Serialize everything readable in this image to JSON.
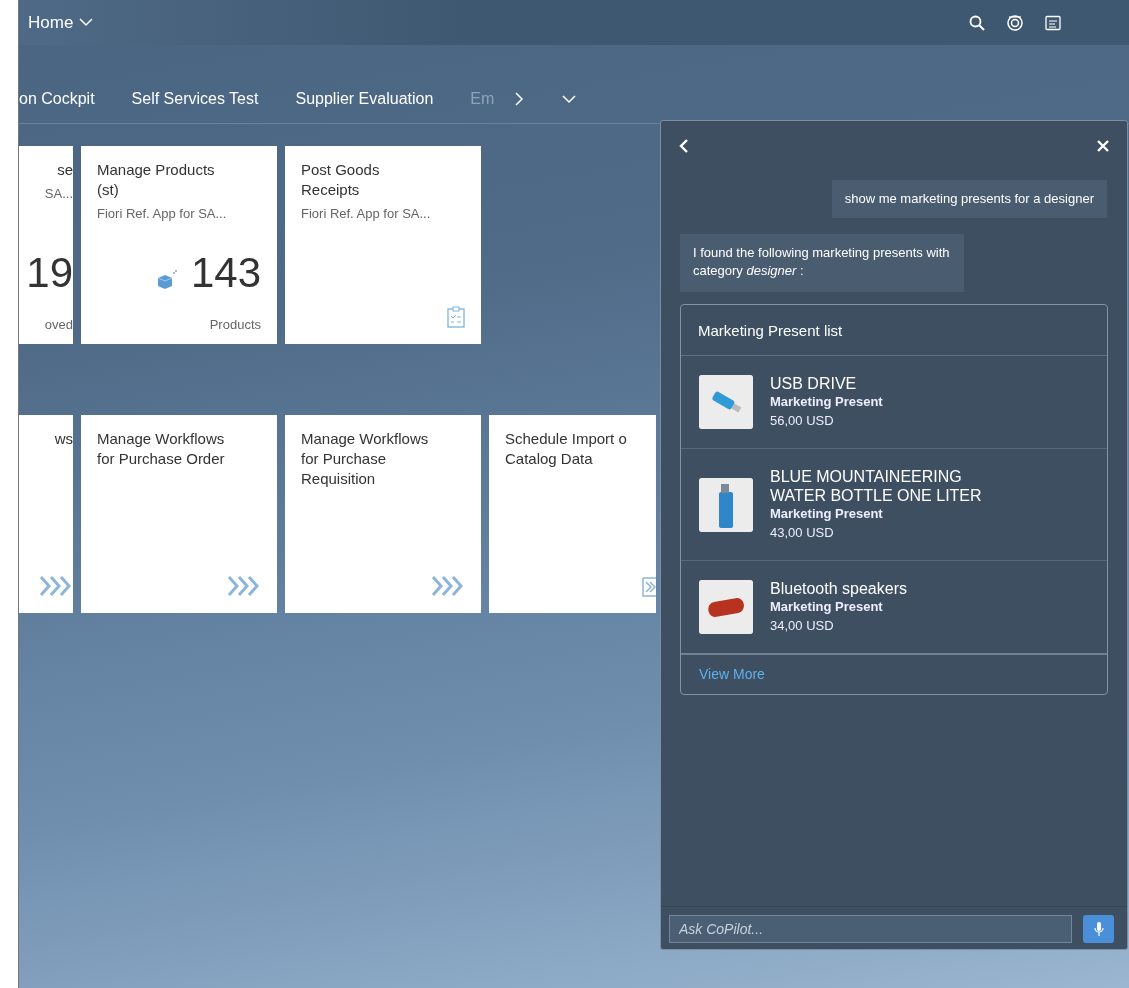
{
  "shell": {
    "title": "Home"
  },
  "tabs": [
    {
      "label": "on Cockpit",
      "dimmed": false
    },
    {
      "label": "Self Services Test",
      "dimmed": false
    },
    {
      "label": "Supplier Evaluation",
      "dimmed": false
    },
    {
      "label": "Em",
      "dimmed": true
    }
  ],
  "groups": [
    {
      "tiles": [
        {
          "kind": "kpi",
          "cut_left": true,
          "title": "se",
          "subtitle": "SA...",
          "number": "19",
          "footer": "oved"
        },
        {
          "kind": "kpi",
          "title": "Manage Products (st)",
          "subtitle": "Fiori Ref. App for SA...",
          "number": "143",
          "footer": "Products"
        },
        {
          "kind": "checklist",
          "title": "Post Goods Receipts",
          "subtitle": "Fiori Ref. App for SA..."
        }
      ]
    },
    {
      "tiles": [
        {
          "kind": "workflow",
          "cut_left": true,
          "title": "ws"
        },
        {
          "kind": "workflow",
          "title": "Manage Workflows for Purchase Order"
        },
        {
          "kind": "workflow",
          "title": "Manage Workflows for Purchase Requisition"
        },
        {
          "kind": "import",
          "cut_right": true,
          "title": "Schedule Import o Catalog Data"
        }
      ]
    }
  ],
  "copilot": {
    "messages": [
      {
        "kind": "user",
        "text": "show me marketing presents for a designer"
      },
      {
        "kind": "bot",
        "text": "I found the following marketing presents with category *designer* :"
      }
    ],
    "card": {
      "title": "Marketing Present list",
      "items": [
        {
          "kind": "usb",
          "name": "USB DRIVE",
          "type": "Marketing Present",
          "price": "56,00 USD"
        },
        {
          "kind": "bottle",
          "name": "BLUE MOUNTAINEERING WATER BOTTLE ONE LITER",
          "type": "Marketing Present",
          "price": "43,00 USD"
        },
        {
          "kind": "speaker",
          "name": "Bluetooth speakers",
          "type": "Marketing Present",
          "price": "34,00 USD"
        }
      ],
      "link": "View More"
    },
    "input": {
      "placeholder": "Ask CoPilot..."
    }
  }
}
